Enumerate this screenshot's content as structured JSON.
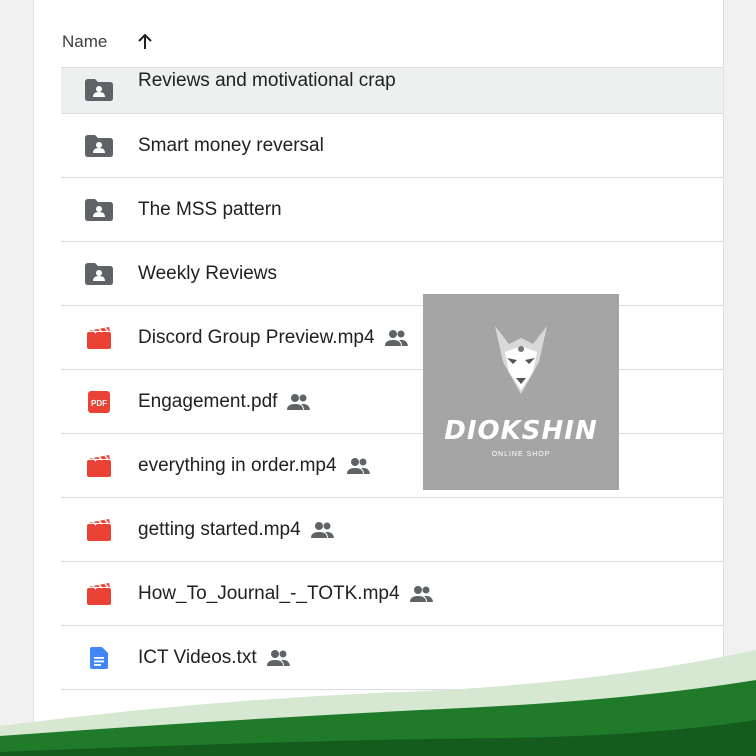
{
  "header": {
    "name_label": "Name",
    "sort_icon": "arrow-up-icon"
  },
  "files": [
    {
      "name": "Reviews and motivational crap",
      "type": "shared-folder",
      "shared": false,
      "selected": true
    },
    {
      "name": "Smart money reversal",
      "type": "shared-folder",
      "shared": false
    },
    {
      "name": "The MSS pattern",
      "type": "shared-folder",
      "shared": false
    },
    {
      "name": "Weekly Reviews",
      "type": "shared-folder",
      "shared": false
    },
    {
      "name": "Discord Group Preview.mp4",
      "type": "video",
      "shared": true
    },
    {
      "name": "Engagement.pdf",
      "type": "pdf",
      "shared": true
    },
    {
      "name": "everything in order.mp4",
      "type": "video",
      "shared": true
    },
    {
      "name": "getting started.mp4",
      "type": "video",
      "shared": true
    },
    {
      "name": "How_To_Journal_-_TOTK.mp4",
      "type": "video",
      "shared": true
    },
    {
      "name": "ICT Videos.txt",
      "type": "doc",
      "shared": true
    }
  ],
  "watermark": {
    "brand": "DIOKSHIN",
    "tagline": "ONLINE SHOP"
  },
  "colors": {
    "folder": "#5f6368",
    "video": "#ea4335",
    "pdf": "#ea4335",
    "doc": "#4285f4",
    "wave_dark": "#1f7a2a",
    "wave_light": "#d6e7d2"
  }
}
